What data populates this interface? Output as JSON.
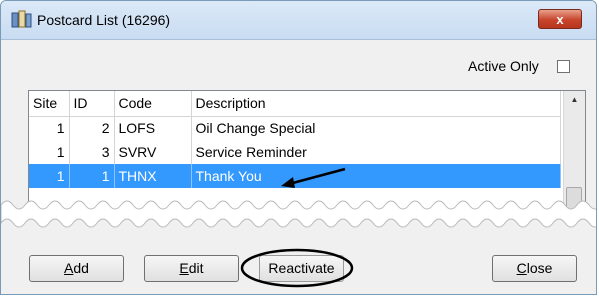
{
  "window": {
    "title": "Postcard List (16296)",
    "close_glyph": "x",
    "icon": "postcard-app-icon"
  },
  "filter": {
    "active_only_label": "Active Only",
    "active_only_checked": false
  },
  "grid": {
    "columns": [
      "Site",
      "ID",
      "Code",
      "Description"
    ],
    "rows": [
      {
        "site": "1",
        "id": "2",
        "code": "LOFS",
        "description": "Oil Change Special",
        "selected": false
      },
      {
        "site": "1",
        "id": "3",
        "code": "SVRV",
        "description": "Service Reminder",
        "selected": false
      },
      {
        "site": "1",
        "id": "1",
        "code": "THNX",
        "description": "Thank You",
        "selected": true
      }
    ],
    "selection_color": "#3399ff"
  },
  "buttons": {
    "add": {
      "pre": "",
      "key": "A",
      "post": "dd"
    },
    "edit": {
      "pre": "",
      "key": "E",
      "post": "dit"
    },
    "reactivate": {
      "label": "Reactivate"
    },
    "close": {
      "pre": "",
      "key": "C",
      "post": "lose"
    }
  },
  "colors": {
    "titlebar": "#c9dcf1",
    "close_button": "#c8452c"
  }
}
